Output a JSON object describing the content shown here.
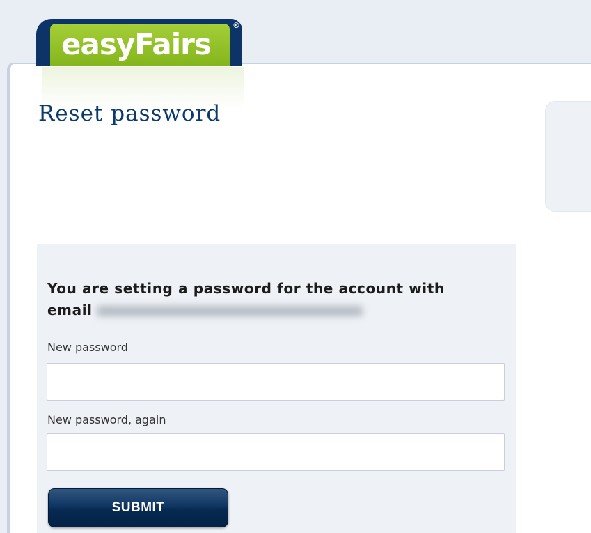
{
  "brand": {
    "logo_text": "easyFairs",
    "registered_mark": "®",
    "colors": {
      "logo_green": "#95c12b",
      "logo_navy": "#0c3466",
      "title_navy": "#0c3a6a",
      "button_navy": "#0f3563"
    }
  },
  "page": {
    "title": "Reset password"
  },
  "form": {
    "heading": "You are setting a password for the account with email",
    "fields": [
      {
        "label": "New password",
        "value": "",
        "placeholder": ""
      },
      {
        "label": "New password, again",
        "value": "",
        "placeholder": ""
      }
    ],
    "submit_label": "SUBMIT"
  }
}
